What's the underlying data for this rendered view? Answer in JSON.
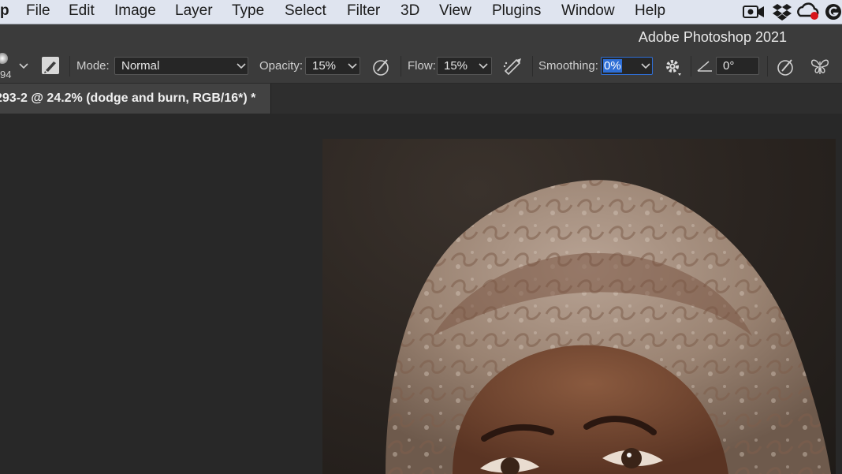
{
  "menubar": {
    "app_menu_fragment": "p",
    "items": [
      "File",
      "Edit",
      "Image",
      "Layer",
      "Type",
      "Select",
      "Filter",
      "3D",
      "View",
      "Plugins",
      "Window",
      "Help"
    ]
  },
  "app_title": "Adobe Photoshop 2021",
  "options": {
    "brush_size": "94",
    "mode_label": "Mode:",
    "mode_value": "Normal",
    "opacity_label": "Opacity:",
    "opacity_value": "15%",
    "flow_label": "Flow:",
    "flow_value": "15%",
    "smoothing_label": "Smoothing:",
    "smoothing_value": "0%",
    "angle_value": "0°"
  },
  "document": {
    "tab_title": "293-2 @ 24.2% (dodge and burn, RGB/16*) *"
  },
  "colors": {
    "menubar_bg": "#dfe4ef",
    "panel_bg": "#3b3b3b",
    "workspace_bg": "#282828",
    "selection_blue": "#2f6fd6"
  }
}
